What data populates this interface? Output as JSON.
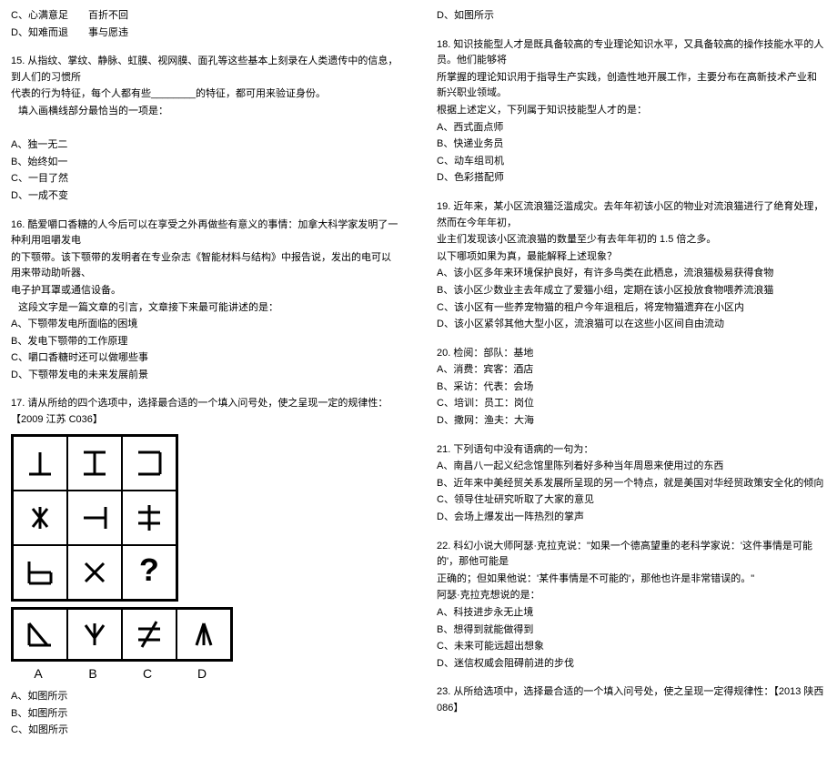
{
  "left": {
    "q14opts": {
      "c": "C、心满意足　　百折不回",
      "d": "D、知难而退　　事与愿违"
    },
    "q15": {
      "stem1": "15. 从指纹、掌纹、静脉、虹膜、视网膜、面孔等这些基本上刻录在人类遗传中的信息，到人们的习惯所",
      "stem2": "代表的行为特征，每个人都有些________的特征，都可用来验证身份。",
      "stem3": "填入画横线部分最恰当的一项是：",
      "a": "A、独一无二",
      "b": "B、始终如一",
      "c": "C、一目了然",
      "d": "D、一成不变"
    },
    "q16": {
      "stem1": "16. 酷爱嚼口香糖的人今后可以在享受之外再做些有意义的事情：加拿大科学家发明了一种利用咀嚼发电",
      "stem2": "的下颚带。该下颚带的发明者在专业杂志《智能材料与结构》中报告说，发出的电可以用来带动助听器、",
      "stem3": "电子护耳罩或通信设备。",
      "stem4": "这段文字是一篇文章的引言，文章接下来最可能讲述的是：",
      "a": "A、下颚带发电所面临的困境",
      "b": "B、发电下颚带的工作原理",
      "c": "C、嚼口香糖时还可以做哪些事",
      "d": "D、下颚带发电的未来发展前景"
    },
    "q17": {
      "stem": "17. 请从所给的四个选项中，选择最合适的一个填入问号处，使之呈现一定的规律性：【2009 江苏 C036】",
      "gridLabels": {
        "a": "A",
        "b": "B",
        "c": "C",
        "d": "D"
      },
      "a": "A、如图所示",
      "b": "B、如图所示",
      "c": "C、如图所示"
    }
  },
  "right": {
    "q17d": "D、如图所示",
    "q18": {
      "stem1": "18. 知识技能型人才是既具备较高的专业理论知识水平，又具备较高的操作技能水平的人员。他们能够将",
      "stem2": "所掌握的理论知识用于指导生产实践，创造性地开展工作，主要分布在高新技术产业和新兴职业领域。",
      "stem3": "根据上述定义，下列属于知识技能型人才的是：",
      "a": "A、西式面点师",
      "b": "B、快递业务员",
      "c": "C、动车组司机",
      "d": "D、色彩搭配师"
    },
    "q19": {
      "stem1": "19. 近年来，某小区流浪猫泛滥成灾。去年年初该小区的物业对流浪猫进行了绝育处理，然而在今年年初，",
      "stem2": "业主们发现该小区流浪猫的数量至少有去年年初的 1.5 倍之多。",
      "stem3": "以下哪项如果为真，最能解释上述现象？",
      "a": "A、该小区多年来环境保护良好，有许多鸟类在此栖息，流浪猫极易获得食物",
      "b": "B、该小区少数业主去年成立了爱猫小组，定期在该小区投放食物喂养流浪猫",
      "c": "C、该小区有一些养宠物猫的租户今年退租后，将宠物猫遗弃在小区内",
      "d": "D、该小区紧邻其他大型小区，流浪猫可以在这些小区间自由流动"
    },
    "q20": {
      "stem": "20. 检阅：部队：基地",
      "a": "A、消费：宾客：酒店",
      "b": "B、采访：代表：会场",
      "c": "C、培训：员工：岗位",
      "d": "D、撒网：渔夫：大海"
    },
    "q21": {
      "stem": "21. 下列语句中没有语病的一句为：",
      "a": "A、南昌八一起义纪念馆里陈列着好多种当年周恩来使用过的东西",
      "b": "B、近年来中美经贸关系发展所呈现的另一个特点，就是美国对华经贸政策安全化的倾向",
      "c": "C、领导住址研究听取了大家的意见",
      "d": "D、会场上爆发出一阵热烈的掌声"
    },
    "q22": {
      "stem1": "22. 科幻小说大师阿瑟·克拉克说：\"如果一个德高望重的老科学家说：'这件事情是可能的'，那他可能是",
      "stem2": "正确的；但如果他说：'某件事情是不可能的'，那他也许是非常错误的。\"",
      "stem3": "阿瑟·克拉克想说的是：",
      "a": "A、科技进步永无止境",
      "b": "B、想得到就能做得到",
      "c": "C、未来可能远超出想象",
      "d": "D、迷信权威会阻碍前进的步伐"
    },
    "q23": {
      "stem": "23. 从所给选项中，选择最合适的一个填入问号处，使之呈现一定得规律性：【2013 陕西 086】"
    }
  }
}
